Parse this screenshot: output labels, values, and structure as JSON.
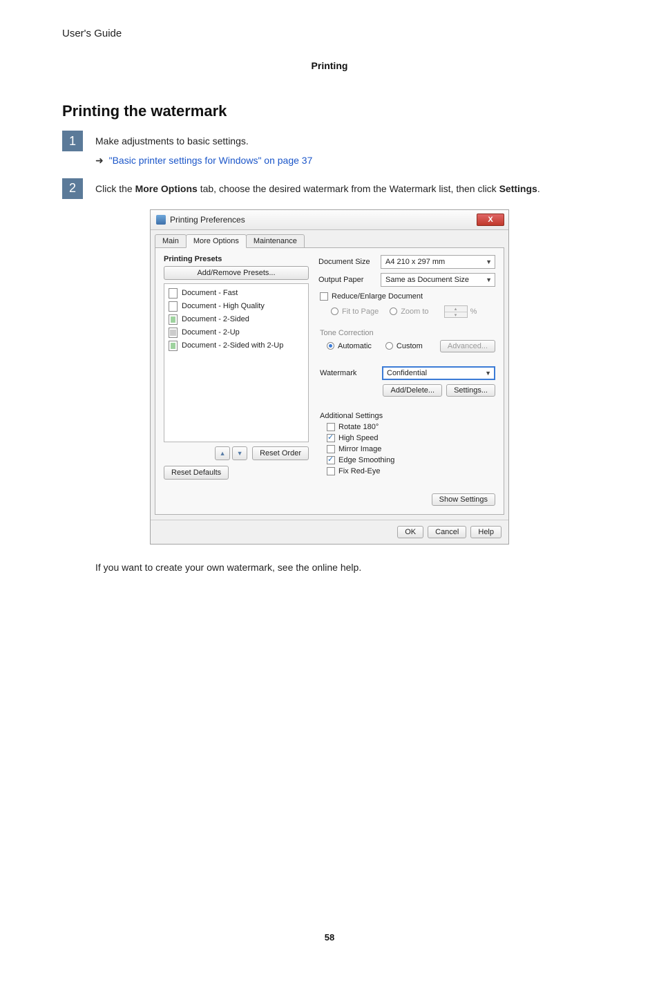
{
  "header": {
    "left": "User's Guide",
    "center": "Printing"
  },
  "section_title": "Printing the watermark",
  "steps": {
    "s1": {
      "num": "1",
      "text": "Make adjustments to basic settings.",
      "link": "\"Basic printer settings for Windows\" on page 37"
    },
    "s2": {
      "num": "2",
      "text_pre": "Click the ",
      "text_bold1": "More Options",
      "text_mid": " tab, choose the desired watermark from the Watermark list, then click ",
      "text_bold2": "Settings",
      "text_post": "."
    }
  },
  "dialog": {
    "title": "Printing Preferences",
    "close": "X",
    "tabs": {
      "main": "Main",
      "more": "More Options",
      "maint": "Maintenance"
    },
    "presets": {
      "title": "Printing Presets",
      "add_remove": "Add/Remove Presets...",
      "items": [
        "Document - Fast",
        "Document - High Quality",
        "Document - 2-Sided",
        "Document - 2-Up",
        "Document - 2-Sided with 2-Up"
      ],
      "reset_order": "Reset Order",
      "reset_defaults": "Reset Defaults"
    },
    "right": {
      "doc_size_label": "Document Size",
      "doc_size_value": "A4 210 x 297 mm",
      "out_paper_label": "Output Paper",
      "out_paper_value": "Same as Document Size",
      "reduce_enlarge": "Reduce/Enlarge Document",
      "fit_to_page": "Fit to Page",
      "zoom_to": "Zoom to",
      "percent": "%",
      "tone_title": "Tone Correction",
      "automatic": "Automatic",
      "custom": "Custom",
      "advanced": "Advanced...",
      "watermark_label": "Watermark",
      "watermark_value": "Confidential",
      "add_delete": "Add/Delete...",
      "settings": "Settings...",
      "additional_title": "Additional Settings",
      "rotate": "Rotate 180°",
      "high_speed": "High Speed",
      "mirror": "Mirror Image",
      "edge": "Edge Smoothing",
      "redeye": "Fix Red-Eye",
      "show_settings": "Show Settings"
    },
    "bottom": {
      "ok": "OK",
      "cancel": "Cancel",
      "help": "Help"
    }
  },
  "footer_text": "If you want to create your own watermark, see the online help.",
  "page_number": "58"
}
